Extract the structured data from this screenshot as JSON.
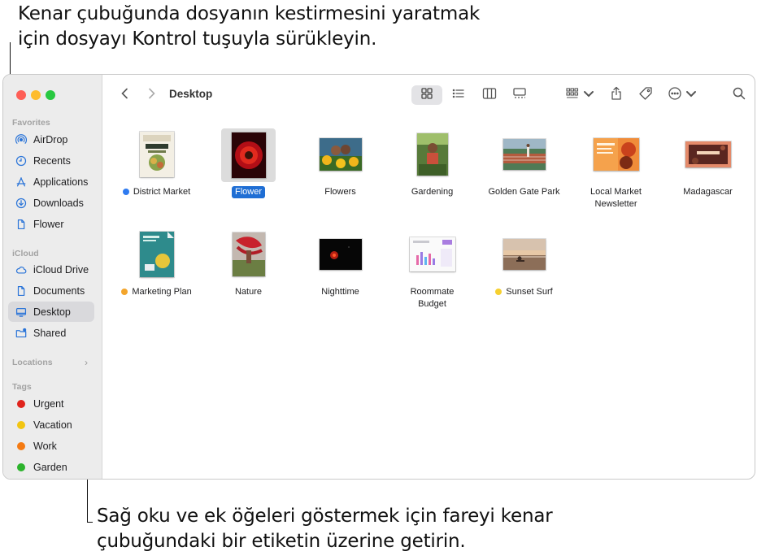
{
  "callouts": {
    "top": [
      "Kenar çubuğunda dosyanın kestirmesini yaratmak",
      "için dosyayı Kontrol tuşuyla sürükleyin."
    ],
    "bottom": [
      "Sağ oku ve ek öğeleri göstermek için fareyi kenar",
      "çubuğundaki bir etiketin üzerine getirin."
    ]
  },
  "window": {
    "title": "Desktop",
    "view_mode": "icons"
  },
  "sidebar": {
    "favorites_header": "Favorites",
    "favorites": [
      {
        "label": "AirDrop",
        "icon": "airdrop-icon"
      },
      {
        "label": "Recents",
        "icon": "clock-icon"
      },
      {
        "label": "Applications",
        "icon": "applications-icon"
      },
      {
        "label": "Downloads",
        "icon": "download-icon"
      },
      {
        "label": "Flower",
        "icon": "document-icon"
      }
    ],
    "icloud_header": "iCloud",
    "icloud": [
      {
        "label": "iCloud Drive",
        "icon": "cloud-icon"
      },
      {
        "label": "Documents",
        "icon": "document-icon"
      },
      {
        "label": "Desktop",
        "icon": "desktop-icon",
        "selected": true
      },
      {
        "label": "Shared",
        "icon": "shared-folder-icon"
      }
    ],
    "locations_header": "Locations",
    "tags_header": "Tags",
    "tags": [
      {
        "label": "Urgent",
        "color": "#e0231c"
      },
      {
        "label": "Vacation",
        "color": "#f2c511"
      },
      {
        "label": "Work",
        "color": "#f47a12"
      },
      {
        "label": "Garden",
        "color": "#2cb32c"
      }
    ]
  },
  "files": [
    {
      "name": "District Market",
      "tag_color": "#2f7bf0"
    },
    {
      "name": "Flower",
      "selected": true
    },
    {
      "name": "Flowers"
    },
    {
      "name": "Gardening"
    },
    {
      "name": "Golden Gate Park"
    },
    {
      "name": "Local Market Newsletter"
    },
    {
      "name": "Madagascar"
    },
    {
      "name": "Marketing Plan",
      "tag_color": "#f3a52b"
    },
    {
      "name": "Nature"
    },
    {
      "name": "Nighttime"
    },
    {
      "name": "Roommate Budget"
    },
    {
      "name": "Sunset Surf",
      "tag_color": "#f6d030"
    }
  ]
}
